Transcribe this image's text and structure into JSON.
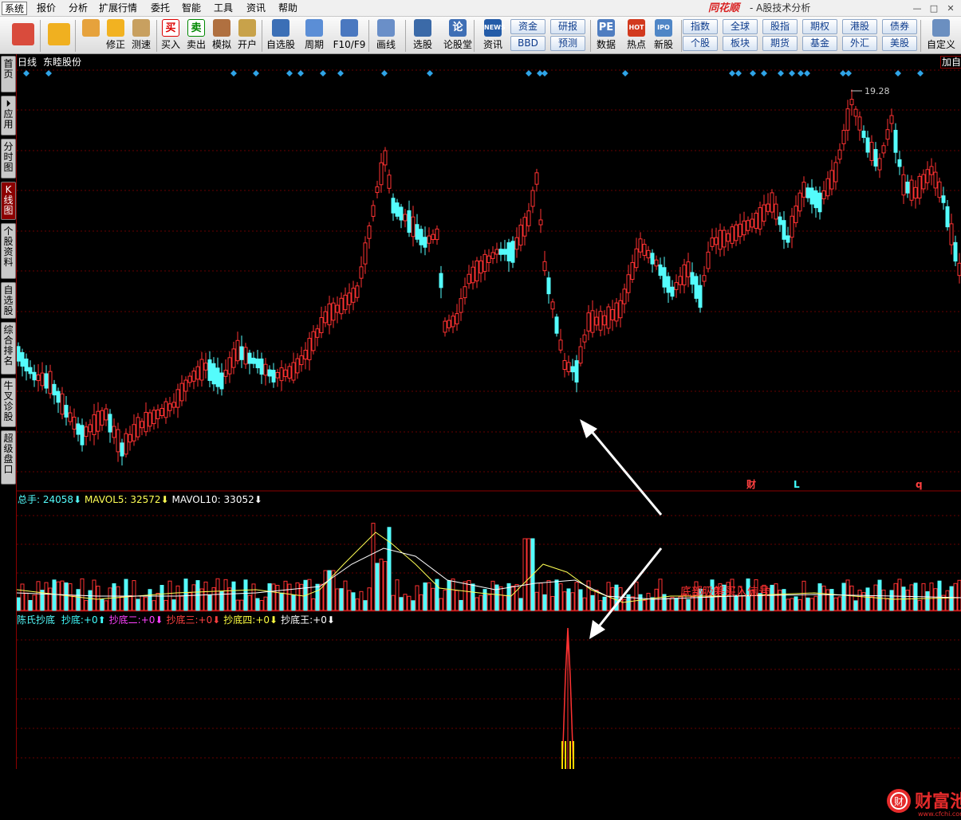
{
  "menubar": {
    "items": [
      "系统",
      "报价",
      "分析",
      "扩展行情",
      "委托",
      "智能",
      "工具",
      "资讯",
      "帮助"
    ],
    "active": 0,
    "brand": "同花顺",
    "brand_sub": "- A股技术分析",
    "win_buttons": [
      "—",
      "□",
      "✕"
    ]
  },
  "toolbar": {
    "buttons": [
      {
        "label": "",
        "icon": "windows-logo-icon"
      },
      {
        "label": "",
        "icon": "back-arrow-icon"
      },
      {
        "label": "",
        "icon": "updown-arrows-icon"
      },
      {
        "label": "修正",
        "icon": "power-icon"
      },
      {
        "label": "测速",
        "icon": "clock-icon"
      },
      {
        "label": "买入",
        "icon": "buy-icon",
        "glyph": "买"
      },
      {
        "label": "卖出",
        "icon": "sell-icon",
        "glyph": "卖"
      },
      {
        "label": "模拟",
        "icon": "hammer-icon"
      },
      {
        "label": "开户",
        "icon": "lock-icon"
      },
      {
        "label": "自选股",
        "icon": "star-icon"
      },
      {
        "label": "周期",
        "icon": "cycle-icon"
      },
      {
        "label": "F10/F9",
        "icon": "f10-icon"
      },
      {
        "label": "画线",
        "icon": "pen-icon"
      },
      {
        "label": "选股",
        "icon": "monitor-icon"
      },
      {
        "label": "论股堂",
        "icon": "forum-icon",
        "glyph": "论"
      },
      {
        "label": "资讯",
        "icon": "news-icon",
        "glyph": "NEWS"
      },
      {
        "label": "数据",
        "icon": "pe-icon",
        "glyph": "PE"
      },
      {
        "label": "热点",
        "icon": "hot-icon",
        "glyph": "HOT"
      },
      {
        "label": "新股",
        "icon": "ipo-icon",
        "glyph": "IPO"
      },
      {
        "label": "自定义",
        "icon": "custom-icon"
      }
    ],
    "small": [
      [
        "资金",
        "BBD"
      ],
      [
        "研报",
        "预测"
      ]
    ],
    "quick": [
      [
        "指数",
        "个股"
      ],
      [
        "全球",
        "板块"
      ],
      [
        "股指",
        "期货"
      ],
      [
        "期权",
        "基金"
      ],
      [
        "港股",
        "外汇"
      ],
      [
        "债券",
        "美股"
      ]
    ]
  },
  "sidebar": {
    "tabs": [
      {
        "label": "首页",
        "active": false
      },
      {
        "label": "应用",
        "prefix": "⏵",
        "active": false
      },
      {
        "label": "分时图",
        "active": false
      },
      {
        "label": "K线图",
        "active": true
      },
      {
        "label": "个股资料",
        "active": false
      },
      {
        "label": "自选股",
        "active": false
      },
      {
        "label": "综合排名",
        "active": false
      },
      {
        "label": "牛叉诊股",
        "active": false
      },
      {
        "label": "超级盘口",
        "active": false
      }
    ]
  },
  "chart_header": {
    "period": "日线",
    "stock": "东睦股份",
    "add_button": "加自"
  },
  "markers": {
    "bottom_labels": [
      "财",
      "L",
      "q"
    ],
    "peak_price": "19.28"
  },
  "volume_header": {
    "total_label": "总手:",
    "total": "24058",
    "total_arrow": "⬇",
    "mavol5_label": "MAVOL5:",
    "mavol5": "32572",
    "mavol5_arrow": "⬇",
    "mavol10_label": "MAVOL10:",
    "mavol10": "33052",
    "mavol10_arrow": "⬇"
  },
  "indicator_header": {
    "name": "陈氏抄底",
    "items": [
      {
        "label": "抄底:",
        "value": "+0",
        "arrow": "⬆",
        "color": "#40ffff"
      },
      {
        "label": "抄底二:",
        "value": "+0",
        "arrow": "⬇",
        "color": "#ff40ff"
      },
      {
        "label": "抄底三:",
        "value": "+0",
        "arrow": "⬇",
        "color": "#ff4040"
      },
      {
        "label": "抄底四:",
        "value": "+0",
        "arrow": "⬇",
        "color": "#ffff40"
      },
      {
        "label": "抄底王:",
        "value": "+0",
        "arrow": "⬇",
        "color": "#ffffff"
      }
    ]
  },
  "annotation": {
    "text": "底部吸筹买入信号"
  },
  "watermark": {
    "text": "财富池",
    "url": "www.cfchi.com"
  },
  "colors": {
    "up": "#ff3232",
    "down": "#54fcfc",
    "grid": "#8b0000",
    "ma5": "#ffff54",
    "ma10": "#ffffff",
    "diamond": "#2fa4e7"
  }
}
